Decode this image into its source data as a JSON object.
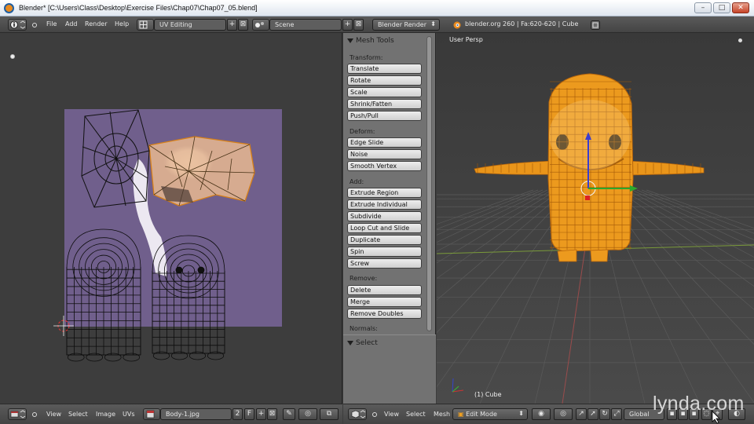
{
  "window": {
    "title": "Blender* [C:\\Users\\Class\\Desktop\\Exercise Files\\Chap07\\Chap07_05.blend]",
    "controls": {
      "minimize": "–",
      "maximize": "□",
      "close": "✕"
    }
  },
  "info_header": {
    "menus": [
      "File",
      "Add",
      "Render",
      "Help"
    ],
    "screen_layout": "UV Editing",
    "scene": "Scene",
    "render_engine": "Blender Render",
    "stats": "blender.org 260 | Fa:620-620 | Cube"
  },
  "uv_editor": {
    "header_menus": [
      "View",
      "Select",
      "Image",
      "UVs"
    ],
    "image_name": "Body-1.jpg",
    "users_count": "2",
    "fake_user": "F",
    "image_bg_color": "#705f8c"
  },
  "toolshelf": {
    "mesh_tools_title": "Mesh Tools",
    "sections": [
      {
        "label": "Transform:",
        "tools": [
          "Translate",
          "Rotate",
          "Scale",
          "Shrink/Fatten",
          "Push/Pull"
        ]
      },
      {
        "label": "Deform:",
        "tools": [
          "Edge Slide",
          "Noise",
          "Smooth Vertex"
        ]
      },
      {
        "label": "Add:",
        "tools": [
          "Extrude Region",
          "Extrude Individual",
          "Subdivide",
          "Loop Cut and Slide",
          "Duplicate",
          "Spin",
          "Screw"
        ]
      },
      {
        "label": "Remove:",
        "tools": [
          "Delete",
          "Merge",
          "Remove Doubles"
        ]
      },
      {
        "label": "Normals:",
        "tools": []
      }
    ],
    "select_title": "Select"
  },
  "viewport": {
    "view_label": "User Persp",
    "object_label": "(1) Cube",
    "header_menus": [
      "View",
      "Select",
      "Mesh"
    ],
    "mode": "Edit Mode",
    "orientation": "Global",
    "mesh_color": "#f0a020"
  },
  "watermark": "lynda.com"
}
